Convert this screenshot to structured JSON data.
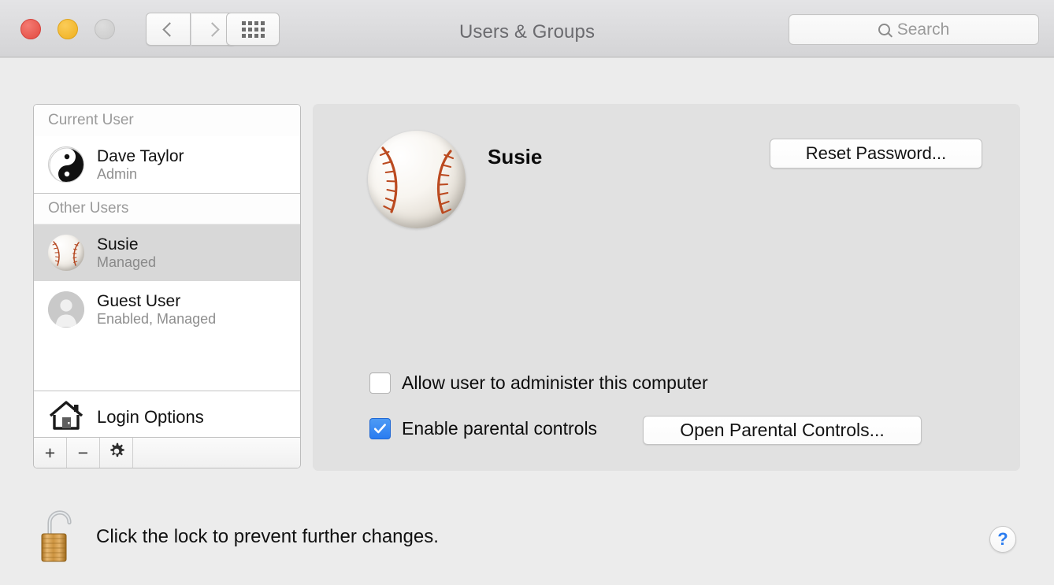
{
  "window": {
    "title": "Users & Groups"
  },
  "titlebar": {
    "traffic": {
      "close": "close-button",
      "minimize": "minimize-button",
      "zoom": "zoom-button"
    },
    "back_icon": "chevron-left-icon",
    "forward_icon": "chevron-right-icon",
    "grid_icon": "show-all-grid-icon"
  },
  "search": {
    "placeholder": "Search",
    "value": "",
    "icon": "search-icon"
  },
  "sidebar": {
    "groups": [
      {
        "header": "Current User",
        "users": [
          {
            "name": "Dave Taylor",
            "role": "Admin",
            "avatar": "yin-yang-avatar",
            "selected": false
          }
        ]
      },
      {
        "header": "Other Users",
        "users": [
          {
            "name": "Susie",
            "role": "Managed",
            "avatar": "baseball-avatar",
            "selected": true
          },
          {
            "name": "Guest User",
            "role": "Enabled, Managed",
            "avatar": "guest-silhouette-avatar",
            "selected": false
          }
        ]
      }
    ],
    "login_options": {
      "label": "Login Options",
      "icon": "house-icon"
    },
    "toolbar": {
      "add_label": "+",
      "remove_label": "−",
      "settings_icon": "gear-icon"
    }
  },
  "account": {
    "name": "Susie",
    "avatar": "baseball-avatar",
    "reset_password_label": "Reset Password...",
    "admin_checkbox": {
      "label": "Allow user to administer this computer",
      "checked": false
    },
    "parental_checkbox": {
      "label": "Enable parental controls",
      "checked": true
    },
    "parental_button_label": "Open Parental Controls..."
  },
  "footer": {
    "lock_icon": "unlocked-padlock-icon",
    "lock_text": "Click the lock to prevent further changes.",
    "help_label": "?"
  },
  "colors": {
    "window_bg": "#ececec",
    "panel_bg": "#e1e1e1",
    "titlebar_top": "#e4e4e6",
    "titlebar_bottom": "#d4d4d6",
    "selection": "#d8d8d8",
    "accent_blue": "#2a7cf0",
    "close_red": "#e24b41",
    "minimize_yellow": "#efb01f",
    "zoom_grey": "#cbcbcb"
  }
}
